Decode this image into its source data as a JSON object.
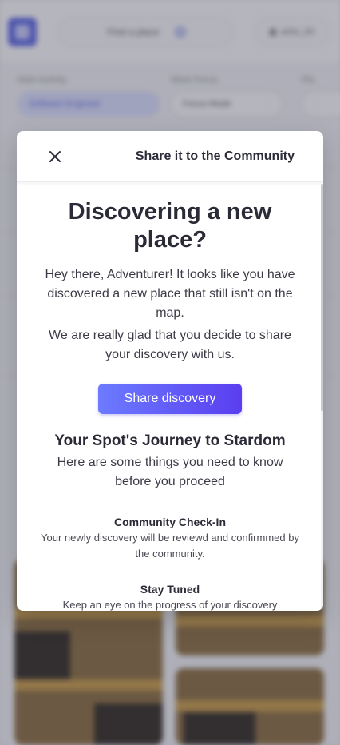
{
  "background": {
    "search_label": "Find a place",
    "user_label": "arles_60",
    "filters": [
      {
        "label": "Main Activity",
        "value": "Software Engineer"
      },
      {
        "label": "Work Focus",
        "value": "Focus Mode"
      },
      {
        "label": "Pla",
        "value": ""
      }
    ]
  },
  "modal": {
    "title": "Share it to the Community",
    "headline": "Discovering a new place?",
    "intro": "Hey there, Adventurer! It looks like you have discovered a new place that still isn't on the map.",
    "intro2": "We are really glad that you decide to share your discovery with us.",
    "share_button": "Share discovery",
    "journey_title": "Your Spot's Journey to Stardom",
    "journey_subtitle": "Here are some things you need to know before you proceed",
    "steps": [
      {
        "title": "Community Check-In",
        "desc": "Your newly discovery will be reviewd and confirmmed by the community."
      },
      {
        "title": "Stay Tuned",
        "desc": "Keep an eye on the progress of your discovery"
      }
    ]
  },
  "colors": {
    "accent_start": "#6c7bff",
    "accent_end": "#5a3ef0",
    "overlay": "rgba(60,62,82,0.38)"
  }
}
